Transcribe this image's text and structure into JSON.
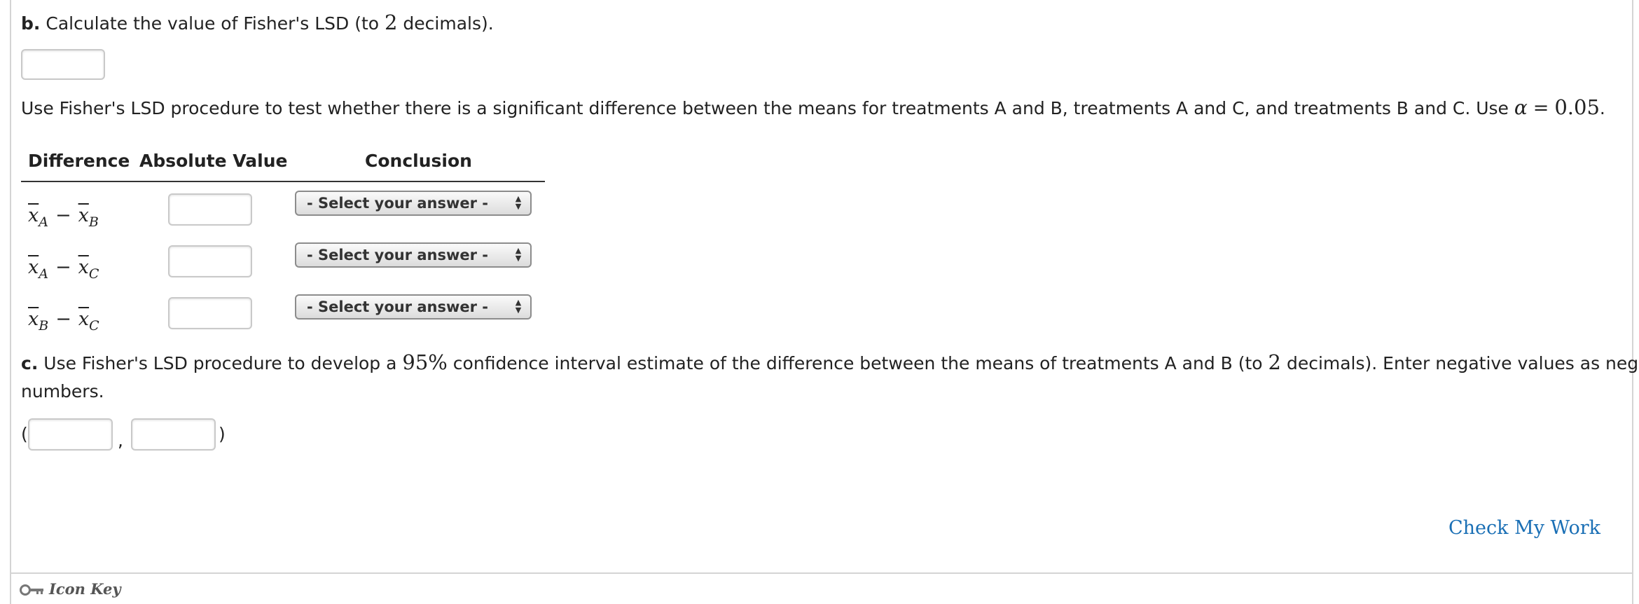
{
  "part_b": {
    "label": "b.",
    "text_pre": "Calculate the value of Fisher's LSD (to ",
    "num": "2",
    "text_post": " decimals).",
    "input_value": ""
  },
  "instructions": {
    "text_pre": "Use Fisher's LSD procedure to test whether there is a significant difference between the means for treatments A and B, treatments A and C, and treatments B and C. Use ",
    "alpha_symbol": "α",
    "equals": "=",
    "alpha_value": "0.05",
    "period": "."
  },
  "table": {
    "headers": [
      "Difference",
      "Absolute Value",
      "Conclusion"
    ],
    "rows": [
      {
        "x1": "x",
        "s1": "A",
        "minus": "−",
        "x2": "x",
        "s2": "B",
        "abs_value": "",
        "conclusion": "- Select your answer -"
      },
      {
        "x1": "x",
        "s1": "A",
        "minus": "−",
        "x2": "x",
        "s2": "C",
        "abs_value": "",
        "conclusion": "- Select your answer -"
      },
      {
        "x1": "x",
        "s1": "B",
        "minus": "−",
        "x2": "x",
        "s2": "C",
        "abs_value": "",
        "conclusion": "- Select your answer -"
      }
    ]
  },
  "part_c": {
    "label": "c.",
    "text_pre": "Use Fisher's LSD procedure to develop a ",
    "pct": "95%",
    "text_mid": " confidence interval estimate of the difference between the means of treatments A and B (to ",
    "num": "2",
    "text_post": " decimals). Enter negative values as negative",
    "line2": "numbers.",
    "open_paren": "(",
    "comma": ",",
    "close_paren": ")",
    "lower_value": "",
    "upper_value": ""
  },
  "check_my_work": "Check My Work",
  "icon_key": "Icon Key",
  "colors": {
    "link": "#1a6fb5",
    "border": "#c9c9c9"
  }
}
